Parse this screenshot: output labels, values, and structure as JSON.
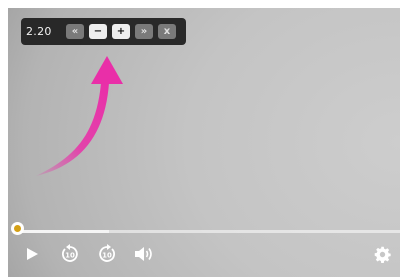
{
  "speed_popup": {
    "value": "2.20",
    "buttons": [
      {
        "name": "speed-slowest-button",
        "label": "«",
        "style": "dim"
      },
      {
        "name": "speed-decrease-button",
        "label": "−",
        "style": "on"
      },
      {
        "name": "speed-increase-button",
        "label": "+",
        "style": "on"
      },
      {
        "name": "speed-fastest-button",
        "label": "»",
        "style": "dim"
      },
      {
        "name": "speed-close-button",
        "label": "x",
        "style": "dim"
      }
    ]
  },
  "annotation": {
    "color": "#e92fa8",
    "icon": "curved-arrow-icon"
  },
  "progress": {
    "played_fraction": 0.0,
    "buffered_fraction": 0.24,
    "handle_color": "#d4a017"
  },
  "controls": {
    "play_icon": "play-icon",
    "rewind_icon": "rewind-10-icon",
    "rewind_label": "10",
    "forward_icon": "forward-10-icon",
    "forward_label": "10",
    "volume_icon": "volume-icon",
    "settings_icon": "gear-icon"
  }
}
